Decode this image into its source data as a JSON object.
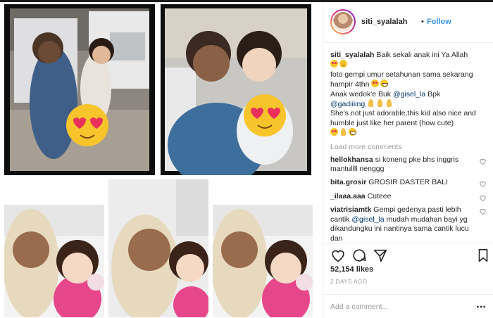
{
  "post": {
    "username": "siti_syalalah",
    "follow_label": "Follow",
    "separator": "•",
    "caption": {
      "username": "siti_syalalah",
      "line1": "Baik sekali anak ini Ya Allah",
      "line2": "foto gempi umur setahunan sama sekarang hampir 4thn",
      "line3a": "Anak wedok'e Buk",
      "mention1": "@gisel_la",
      "line3b": "Bpk",
      "mention2": "@gadiiiing",
      "line4": "She's not just adorable,this kid also nice and humble just like her parent (how cute)"
    },
    "load_more_label": "Load more comments",
    "comments": [
      {
        "username": "hellokhansa",
        "text": "si koneng pke bhs inggris mantullll nenggg"
      },
      {
        "username": "bita.grosir",
        "text": "GROSIR DASTER BALI"
      },
      {
        "username": "_ilaaa.aaa",
        "text": "Cuteee"
      },
      {
        "username": "viatrisiamtk",
        "text_a": "Gempi gedenya pasti lebih cantik",
        "mention": "@gisel_la",
        "text_b": "mudah mudahan bayi yg dikandungku ini nantinya sama cantik lucu dan"
      }
    ],
    "likes": "52,154 likes",
    "timestamp": "2 DAYS AGO",
    "add_comment_placeholder": "Add a comment...",
    "icons": {
      "like": "heart-icon",
      "comment": "comment-bubble-icon",
      "share": "share-icon",
      "save": "bookmark-icon",
      "more": "more-options-icon",
      "sticker": "heart-eyes-emoji-sticker"
    },
    "colors": {
      "link": "#3897f0",
      "mention": "#003569",
      "muted": "#999999",
      "sticker": "#f7c42b"
    }
  }
}
